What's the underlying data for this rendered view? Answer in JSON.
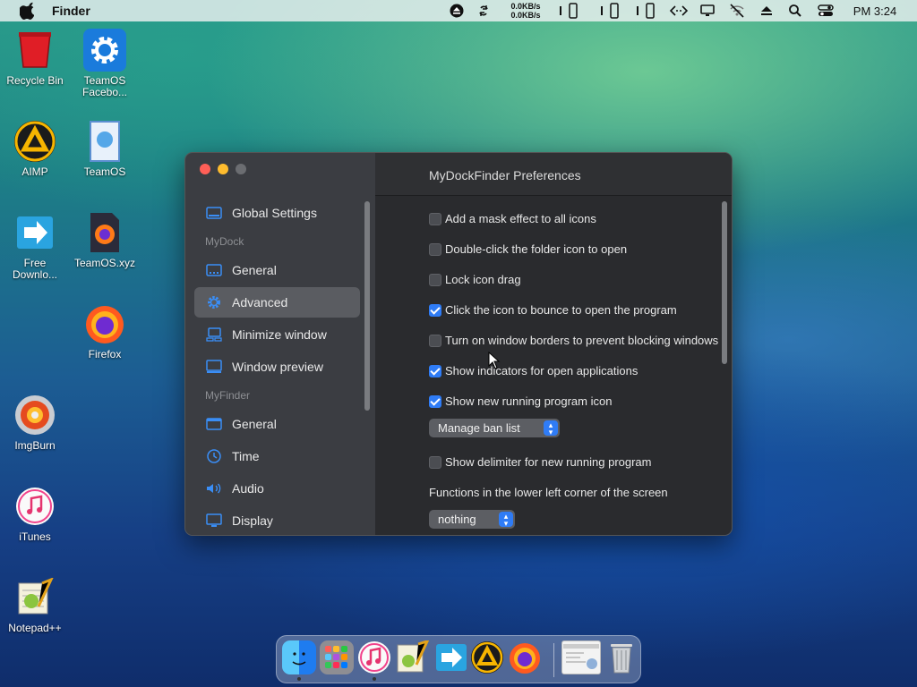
{
  "menubar": {
    "app_name": "Finder",
    "net_up": "0.0KB/s",
    "net_down": "0.0KB/s",
    "clock": "PM 3:24",
    "icons": [
      "apple-icon",
      "eject-circle-icon",
      "refresh-icon",
      "phone-icon",
      "phone-icon",
      "phone-icon",
      "code-arrows-icon",
      "monitor-icon",
      "wifi-off-icon",
      "eject-icon",
      "search-icon",
      "control-center-icon"
    ]
  },
  "desktop": {
    "icons": [
      {
        "label": "Recycle Bin",
        "icon": "recycle-bin-icon"
      },
      {
        "label": "TeamOS Facebo...",
        "icon": "gear-icon"
      },
      {
        "label": "AIMP",
        "icon": "aimp-icon"
      },
      {
        "label": "TeamOS",
        "icon": "document-icon"
      },
      {
        "label": "Free Downlo...",
        "icon": "download-arrow-icon"
      },
      {
        "label": "TeamOS.xyz",
        "icon": "firefox-file-icon"
      },
      {
        "label": "Firefox",
        "icon": "firefox-icon"
      },
      {
        "label": "ImgBurn",
        "icon": "disc-icon"
      },
      {
        "label": "iTunes",
        "icon": "music-icon"
      },
      {
        "label": "Notepad++",
        "icon": "notepad-icon"
      }
    ]
  },
  "window": {
    "title": "MyDockFinder Preferences",
    "sidebar": {
      "global": "Global Settings",
      "section_mydock": "MyDock",
      "section_myfinder": "MyFinder",
      "mydock_items": [
        "General",
        "Advanced",
        "Minimize window",
        "Window preview"
      ],
      "myfinder_items": [
        "General",
        "Time",
        "Audio",
        "Display"
      ],
      "selected": "Advanced"
    },
    "options": [
      {
        "label": "Add a mask effect to all icons",
        "checked": false
      },
      {
        "label": "Double-click the folder icon to open",
        "checked": false
      },
      {
        "label": "Lock icon drag",
        "checked": false
      },
      {
        "label": "Click the icon to bounce to open the program",
        "checked": true
      },
      {
        "label": "Turn on window borders to prevent blocking windows",
        "checked": false
      },
      {
        "label": "Show indicators for open applications",
        "checked": true
      },
      {
        "label": "Show new running program icon",
        "checked": true
      }
    ],
    "ban_list_button": "Manage ban list",
    "delimiter_option": {
      "label": "Show delimiter for new running program",
      "checked": false
    },
    "corner_label": "Functions in the lower left corner of the screen",
    "corner_value": "nothing"
  },
  "dock": {
    "items": [
      "finder-icon",
      "launchpad-icon",
      "itunes-icon",
      "notepad-icon",
      "download-arrow-icon",
      "aimp-icon",
      "firefox-icon",
      "window-thumbnail-icon",
      "trash-icon"
    ]
  },
  "colors": {
    "accent": "#2f7cf6",
    "close": "#ff5f57",
    "minimize": "#febc2e",
    "zoom": "#6b6d71"
  }
}
